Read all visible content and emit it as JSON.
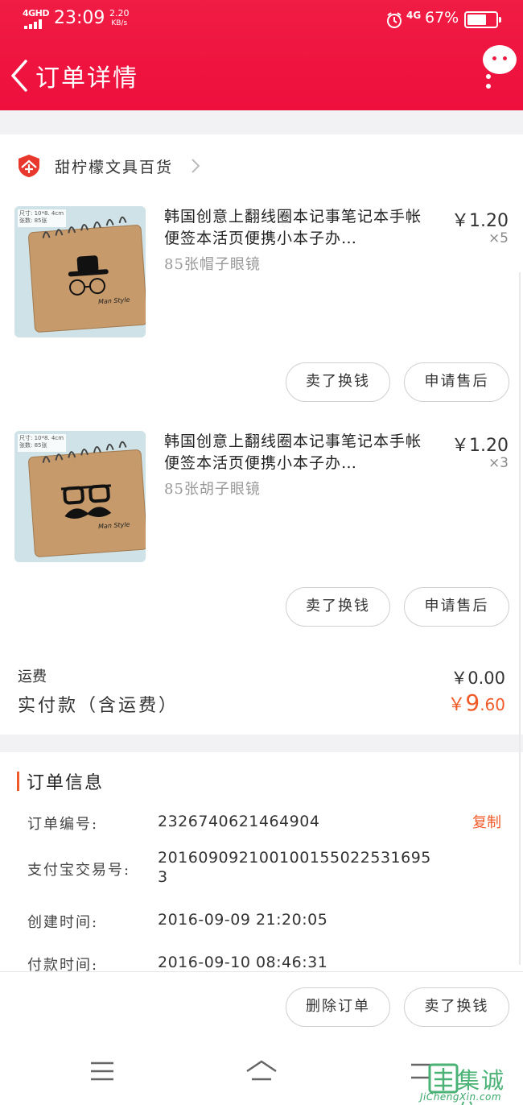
{
  "status_bar": {
    "network": "4GHD",
    "time": "23:09",
    "speed_value": "2.20",
    "speed_unit": "KB/s",
    "network_right": "4G",
    "battery_percent": "67%",
    "battery_level": 0.67
  },
  "header": {
    "title": "订单详情",
    "back_icon": "chevron-left-icon",
    "more_icon": "more-vertical-icon"
  },
  "shop": {
    "name": "甜柠檬文具百货",
    "badge_text": "企"
  },
  "items": [
    {
      "title": "韩国创意上翻线圈本记事笔记本手帐便签本活页便携小本子办…",
      "spec": "85张帽子眼镜",
      "price": "￥1.20",
      "qty": "×5",
      "thumb_note_1": "尺寸: 10*8. 4cm",
      "thumb_note_2": "张数: 85张",
      "thumb_brand": "Man Style",
      "buttons": [
        "卖了换钱",
        "申请售后"
      ]
    },
    {
      "title": "韩国创意上翻线圈本记事笔记本手帐便签本活页便携小本子办…",
      "spec": "85张胡子眼镜",
      "price": "￥1.20",
      "qty": "×3",
      "thumb_note_1": "尺寸: 10*8. 4cm",
      "thumb_note_2": "张数: 85张",
      "thumb_brand": "Man Style",
      "buttons": [
        "卖了换钱",
        "申请售后"
      ]
    }
  ],
  "totals": {
    "shipping_label": "运费",
    "shipping_value": "￥0.00",
    "paid_label": "实付款（含运费）",
    "paid_currency": "￥",
    "paid_integer": "9",
    "paid_decimal": ".60"
  },
  "order_info": {
    "section_title": "订单信息",
    "copy_label": "复制",
    "rows": [
      {
        "label": "订单编号:",
        "value": "2326740621464904"
      },
      {
        "label": "支付宝交易号:",
        "value": "201609092100100155022531695 3"
      },
      {
        "label": "创建时间:",
        "value": "2016-09-09 21:20:05"
      },
      {
        "label": "付款时间:",
        "value": "2016-09-10 08:46:31"
      }
    ]
  },
  "bottom_actions": {
    "delete_label": "删除订单",
    "sell_label": "卖了换钱"
  },
  "watermark": {
    "text": "集诚信",
    "url": "JiChengXin.com"
  },
  "colors": {
    "brand_red": "#f01c44",
    "accent_orange": "#f05a28"
  }
}
